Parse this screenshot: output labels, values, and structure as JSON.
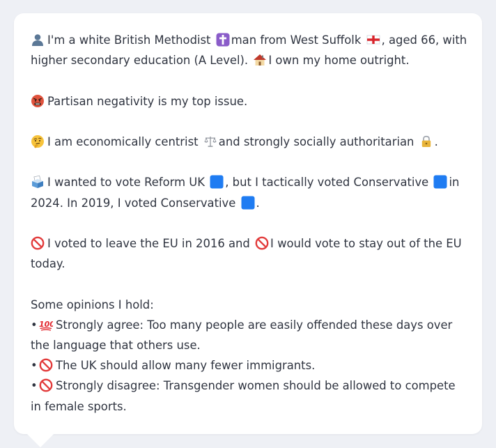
{
  "profile": {
    "identity": {
      "line1_a": "I'm a white British Methodist",
      "line1_b": "man from West Suffolk",
      "line1_c": ", aged 66, with",
      "line2_a": "higher secondary education (A Level).",
      "line2_b": "I own my home outright."
    },
    "top_issue": "Partisan negativity is my top issue.",
    "ideology": {
      "a": "I am economically centrist",
      "b": "and strongly socially authoritarian",
      "c": "."
    },
    "vote": {
      "line1_a": "I wanted to vote Reform UK",
      "line1_b": ", but I tactically voted Conservative",
      "line1_c": "in",
      "line2_a": "2024. In 2019, I voted Conservative",
      "line2_b": "."
    },
    "eu": {
      "line1_a": "I voted to leave the EU in 2016 and",
      "line1_b": "I would vote to stay out of the EU",
      "line2": "today."
    },
    "opinions_heading": "Some opinions I hold:",
    "bullet_char": "•",
    "opinions": [
      {
        "icon": "hundred-points-icon",
        "line1": "Strongly agree: Too many people are easily offended these days over",
        "line2": "the language that others use."
      },
      {
        "icon": "no-entry-icon",
        "line1": "The UK should allow many fewer immigrants.",
        "line2": ""
      },
      {
        "icon": "no-entry-icon",
        "line1": "Strongly disagree: Transgender women should be allowed to compete",
        "line2": "in female sports."
      }
    ]
  },
  "colors": {
    "background": "#eef0f5",
    "card": "#ffffff",
    "text": "#2f3440",
    "blue_square": "#1f7cf2",
    "no_entry": "#e23b3b",
    "cross_purple": "#8a5cc9"
  }
}
